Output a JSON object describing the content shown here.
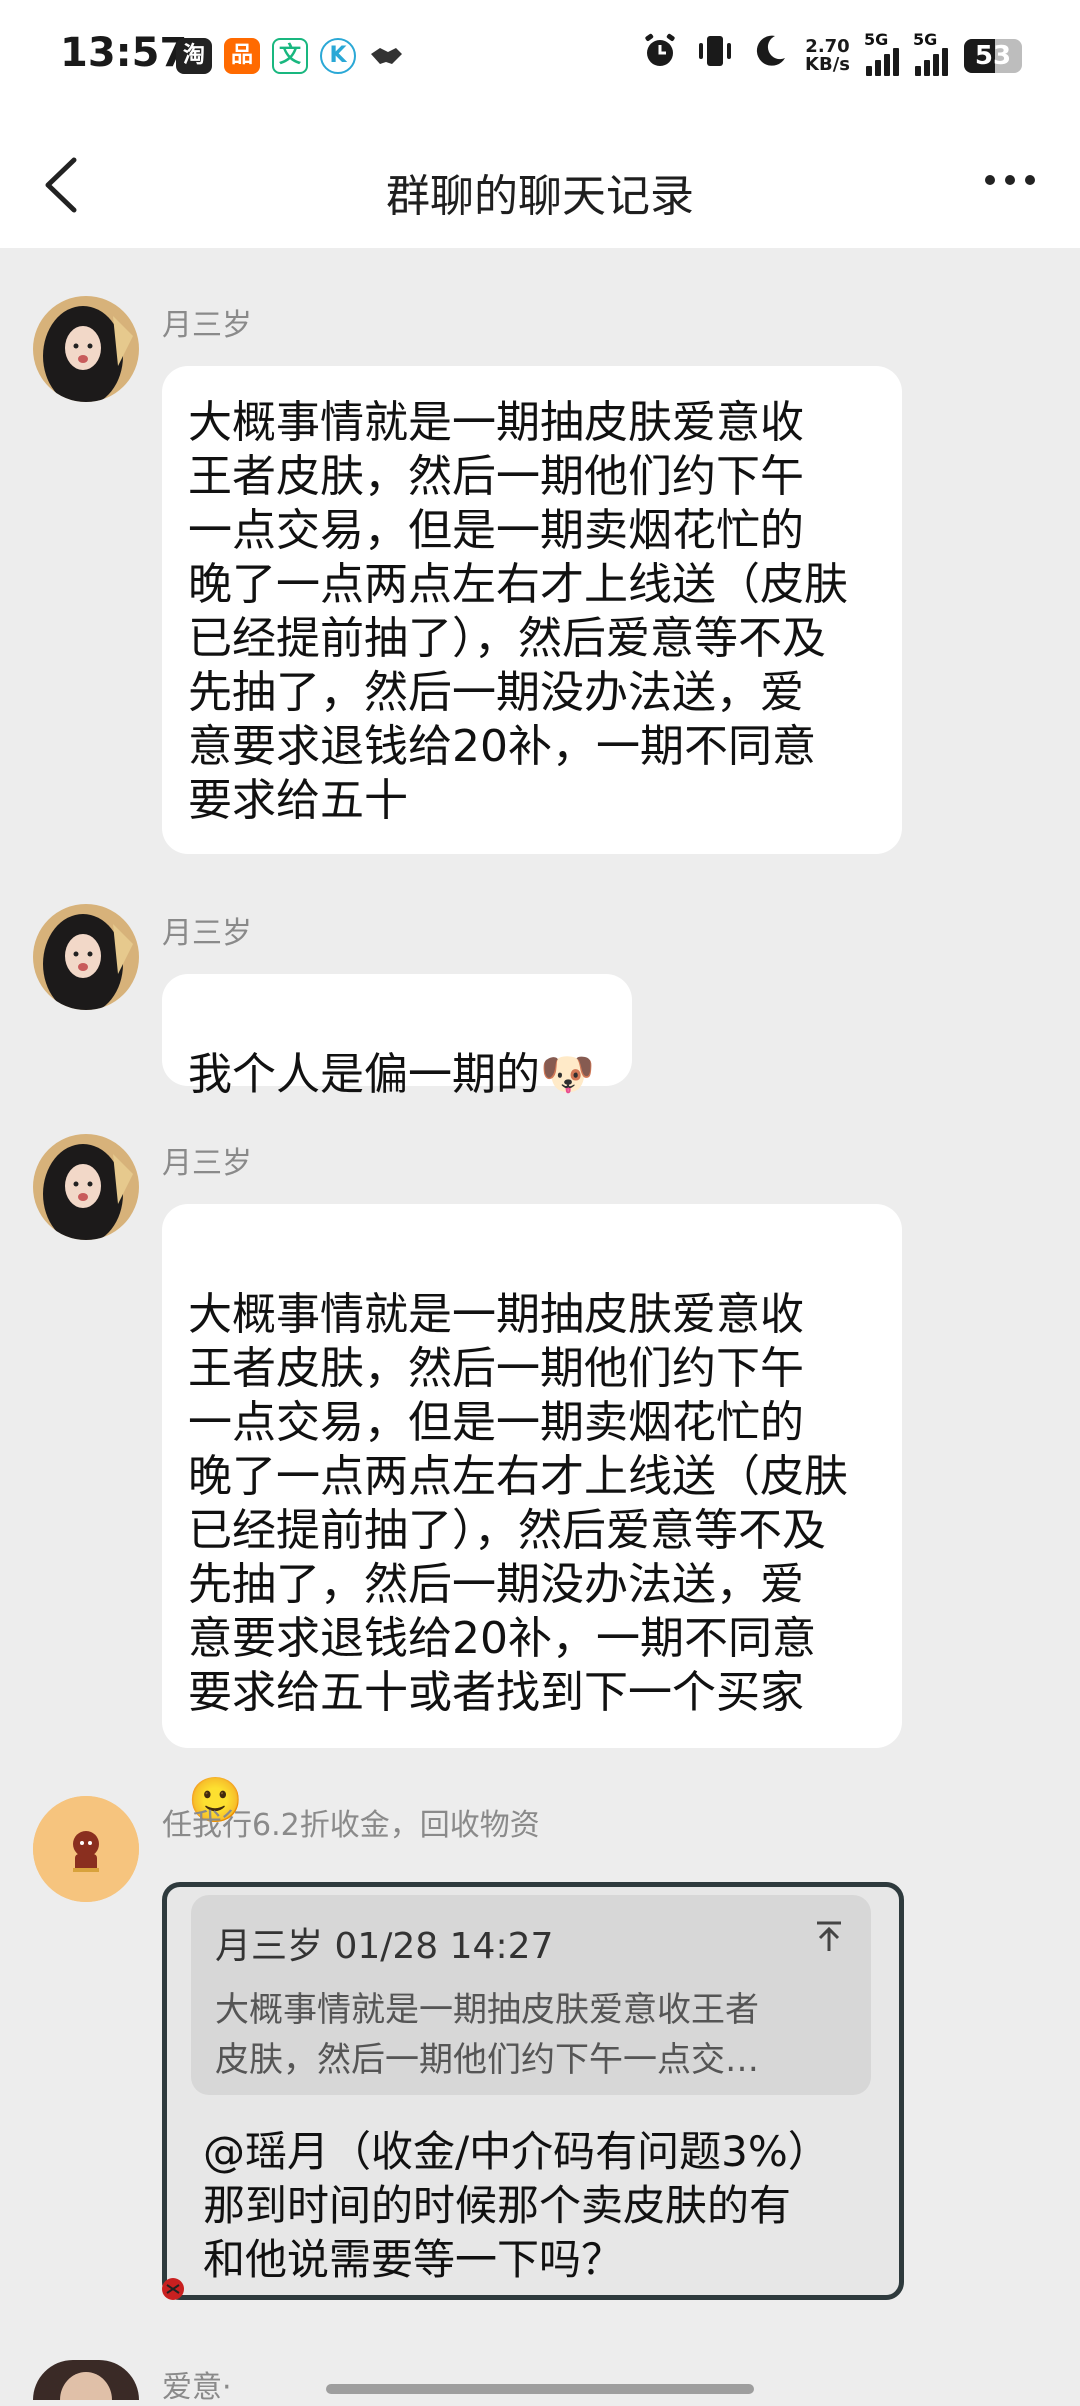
{
  "status_bar": {
    "time": "13:57",
    "apps": [
      {
        "icon": "taobao-icon",
        "glyph": "淘",
        "color": "#222222"
      },
      {
        "icon": "app-icon",
        "glyph": "品",
        "color": "#ff6a00"
      },
      {
        "icon": "translate-icon",
        "glyph": "文",
        "color": "#19b77f"
      },
      {
        "icon": "k-icon",
        "glyph": "K",
        "color": "#2aa8d6"
      },
      {
        "icon": "handshake-icon",
        "glyph": "🤝",
        "color": "#333333"
      }
    ],
    "net_speed_value": "2.70",
    "net_speed_unit": "KB/s",
    "signal_1_label": "5G",
    "signal_2_label": "5G",
    "battery_level": "53",
    "battery_fraction": 0.53
  },
  "header": {
    "title": "群聊的聊天记录"
  },
  "messages": [
    {
      "sender": "月三岁",
      "text": "大概事情就是一期抽皮肤爱意收\n王者皮肤，然后一期他们约下午\n一点交易，但是一期卖烟花忙的\n晚了一点两点左右才上线送（皮肤\n已经提前抽了），然后爱意等不及\n先抽了，然后一期没办法送，爱\n意要求退钱给20补，一期不同意\n要求给五十"
    },
    {
      "sender": "月三岁",
      "text": "我个人是偏一期的",
      "emoji": "🐶"
    },
    {
      "sender": "月三岁",
      "text": "大概事情就是一期抽皮肤爱意收\n王者皮肤，然后一期他们约下午\n一点交易，但是一期卖烟花忙的\n晚了一点两点左右才上线送（皮肤\n已经提前抽了），然后爱意等不及\n先抽了，然后一期没办法送，爱\n意要求退钱给20补，一期不同意\n要求给五十或者找到下一个买家",
      "emoji": "🙂"
    },
    {
      "sender": "任我行6.2折收金，回收物资",
      "quote": {
        "header": "月三岁 01/28 14:27",
        "text": "大概事情就是一期抽皮肤爱意收王者\n皮肤，然后一期他们约下午一点交…"
      },
      "text": "@瑶月（收金/中介码有问题3%）\n那到时间的时候那个卖皮肤的有\n和他说需要等一下吗？"
    },
    {
      "sender": "爱意·"
    }
  ]
}
